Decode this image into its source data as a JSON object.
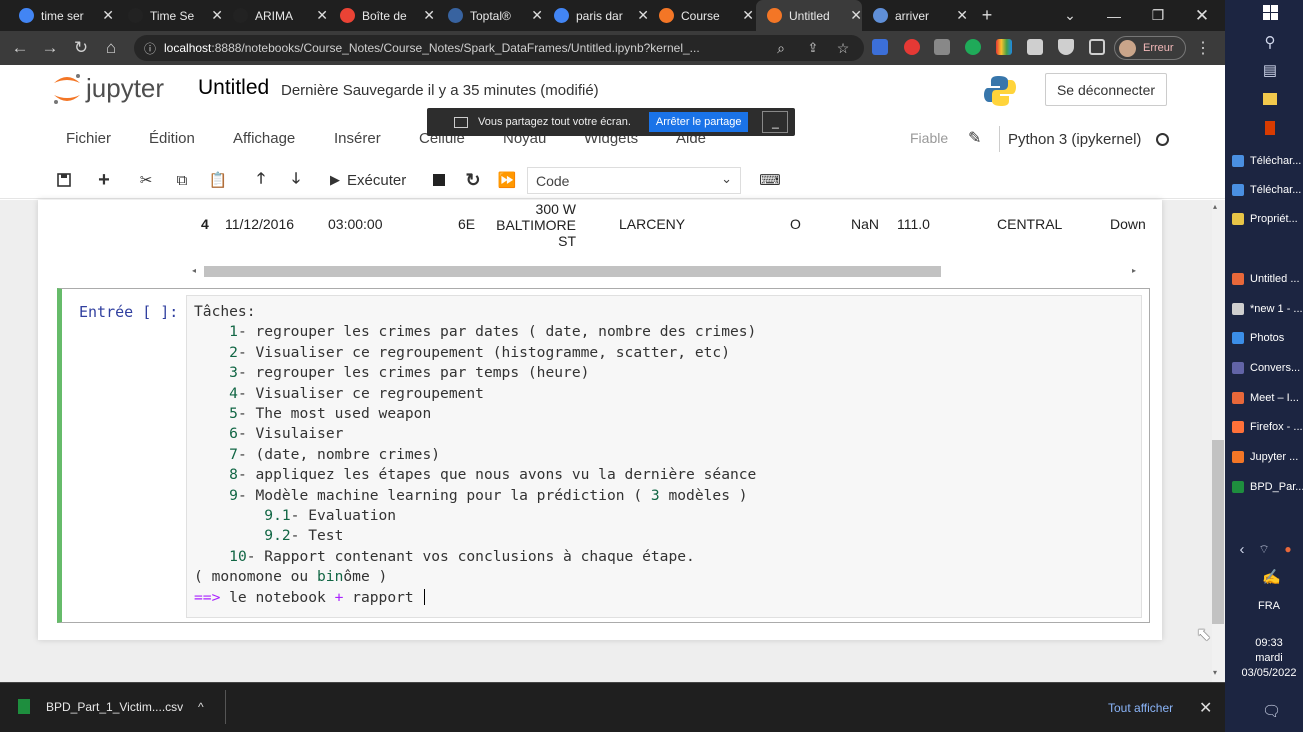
{
  "browser": {
    "tabs": [
      {
        "title": "time ser",
        "icon": "chrome-icon",
        "color": "#4285f4",
        "active": false
      },
      {
        "title": "Time Se",
        "icon": "medium-icon",
        "color": "#222222",
        "active": false
      },
      {
        "title": "ARIMA",
        "icon": "medium-icon",
        "color": "#222222",
        "active": false
      },
      {
        "title": "Boîte de",
        "icon": "gmail-icon",
        "color": "#ea4335",
        "active": false
      },
      {
        "title": "Toptal®",
        "icon": "toptal-icon",
        "color": "#3863a0",
        "active": false
      },
      {
        "title": "paris dar",
        "icon": "google-icon",
        "color": "#4285f4",
        "active": false
      },
      {
        "title": "Course",
        "icon": "jupyter-icon",
        "color": "#f37626",
        "active": false
      },
      {
        "title": "Untitled",
        "icon": "jupyter-icon",
        "color": "#f37626",
        "active": true
      },
      {
        "title": "arriver",
        "icon": "globe-icon",
        "color": "#5f8fd8",
        "active": false
      }
    ],
    "url_host": "localhost",
    "url_rest": ":8888/notebooks/Course_Notes/Course_Notes/Spark_DataFrames/Untitled.ipynb?kernel_...",
    "profile_label": "Erreur"
  },
  "jupyter": {
    "logo_text": "jupyter",
    "notebook_name": "Untitled",
    "save_status": "Dernière Sauvegarde   il y a 35 minutes   (modifié)",
    "logout": "Se déconnecter",
    "menus": [
      "Fichier",
      "Édition",
      "Affichage",
      "Insérer",
      "Cellule",
      "Noyau",
      "Widgets",
      "Aide"
    ],
    "trusted": "Fiable",
    "kernel": "Python 3 (ipykernel)",
    "run_label": "Exécuter",
    "cell_type": "Code"
  },
  "share_banner": {
    "text": "Vous partagez tout votre écran.",
    "stop": "Arrêter le partage",
    "hide": "_"
  },
  "output_row": {
    "index": "4",
    "date": "11/12/2016",
    "time": "03:00:00",
    "code": "6E",
    "location_l1": "300 W",
    "location_l2": "BALTIMORE",
    "location_l3": "ST",
    "description": "LARCENY",
    "inout": "O",
    "weapon": "NaN",
    "post": "111.0",
    "district": "CENTRAL",
    "neighborhood": "Down"
  },
  "input_cell": {
    "prompt": "Entrée [ ]:",
    "lines": [
      {
        "indent": "",
        "parts": [
          {
            "t": "Tâches:",
            "c": ""
          }
        ]
      },
      {
        "indent": "    ",
        "parts": [
          {
            "t": "1",
            "c": "num"
          },
          {
            "t": "- regrouper les crimes par dates ( date, nombre des crimes)",
            "c": ""
          }
        ]
      },
      {
        "indent": "    ",
        "parts": [
          {
            "t": "2",
            "c": "num"
          },
          {
            "t": "- Visualiser ce regroupement (histogramme, scatter, etc)",
            "c": ""
          }
        ]
      },
      {
        "indent": "    ",
        "parts": [
          {
            "t": "3",
            "c": "num"
          },
          {
            "t": "- regrouper les crimes par temps (heure)",
            "c": ""
          }
        ]
      },
      {
        "indent": "    ",
        "parts": [
          {
            "t": "4",
            "c": "num"
          },
          {
            "t": "- Visualiser ce regroupement",
            "c": ""
          }
        ]
      },
      {
        "indent": "    ",
        "parts": [
          {
            "t": "5",
            "c": "num"
          },
          {
            "t": "- The most used weapon",
            "c": ""
          }
        ]
      },
      {
        "indent": "    ",
        "parts": [
          {
            "t": "6",
            "c": "num"
          },
          {
            "t": "- Visulaiser",
            "c": ""
          }
        ]
      },
      {
        "indent": "    ",
        "parts": [
          {
            "t": "7",
            "c": "num"
          },
          {
            "t": "- (date, nombre crimes)",
            "c": ""
          }
        ]
      },
      {
        "indent": "    ",
        "parts": [
          {
            "t": "8",
            "c": "num"
          },
          {
            "t": "- appliquez les étapes que nous avons vu la dernière séance",
            "c": ""
          }
        ]
      },
      {
        "indent": "    ",
        "parts": [
          {
            "t": "9",
            "c": "num"
          },
          {
            "t": "- Modèle machine learning pour la prédiction ( ",
            "c": ""
          },
          {
            "t": "3",
            "c": "num"
          },
          {
            "t": " modèles )",
            "c": ""
          }
        ]
      },
      {
        "indent": "        ",
        "parts": [
          {
            "t": "9.1",
            "c": "num"
          },
          {
            "t": "- Evaluation",
            "c": ""
          }
        ]
      },
      {
        "indent": "        ",
        "parts": [
          {
            "t": "9.2",
            "c": "num"
          },
          {
            "t": "- Test",
            "c": ""
          }
        ]
      },
      {
        "indent": "    ",
        "parts": [
          {
            "t": "10",
            "c": "num"
          },
          {
            "t": "- Rapport contenant vos conclusions à chaque étape.",
            "c": ""
          }
        ]
      },
      {
        "indent": "",
        "parts": [
          {
            "t": "( monomone ou ",
            "c": ""
          },
          {
            "t": "bin",
            "c": "num"
          },
          {
            "t": "ôme )",
            "c": ""
          }
        ]
      },
      {
        "indent": "",
        "parts": [
          {
            "t": "==>",
            "c": "op"
          },
          {
            "t": " le notebook ",
            "c": ""
          },
          {
            "t": "+",
            "c": "op"
          },
          {
            "t": " rapport ",
            "c": ""
          }
        ]
      }
    ]
  },
  "download": {
    "file": "BPD_Part_1_Victim....csv",
    "show_all": "Tout afficher"
  },
  "taskbar": {
    "items": [
      {
        "label": "Téléchar...",
        "color": "#4a90e2"
      },
      {
        "label": "Téléchar...",
        "color": "#4a90e2"
      },
      {
        "label": "Propriét...",
        "color": "#e8c547"
      },
      {
        "label": "Untitled ...",
        "color": "#e8683a"
      },
      {
        "label": "*new 1 - ...",
        "color": "#cfcfcf"
      },
      {
        "label": "Photos",
        "color": "#3b8ee8"
      },
      {
        "label": "Convers...",
        "color": "#6264a7"
      },
      {
        "label": "Meet – I...",
        "color": "#e8683a"
      },
      {
        "label": "Firefox - ...",
        "color": "#ff7139"
      },
      {
        "label": "Jupyter ...",
        "color": "#f37626"
      },
      {
        "label": "BPD_Par...",
        "color": "#1e8e3e"
      }
    ],
    "lang": "FRA",
    "time": "09:33",
    "day": "mardi",
    "date": "03/05/2022"
  }
}
